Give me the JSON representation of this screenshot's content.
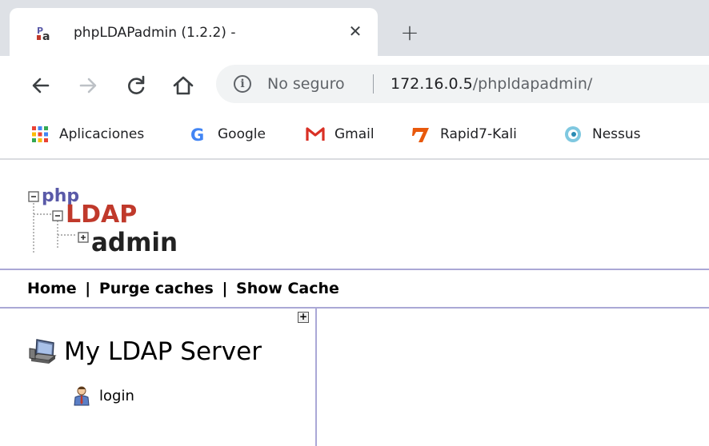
{
  "browser": {
    "tab": {
      "title": "phpLDAPadmin (1.2.2) -",
      "close_glyph": "✕"
    },
    "new_tab_glyph": "+",
    "toolbar": {
      "back_icon": "arrow-left-icon",
      "forward_icon": "arrow-right-icon",
      "reload_icon": "reload-icon",
      "home_icon": "home-icon"
    },
    "omnibox": {
      "security_label": "No seguro",
      "url_host": "172.16.0.5",
      "url_path": "/phpldapadmin/"
    },
    "bookmarks": [
      {
        "label": "Aplicaciones",
        "icon": "apps-grid-icon"
      },
      {
        "label": "Google",
        "icon": "google-icon"
      },
      {
        "label": "Gmail",
        "icon": "gmail-icon"
      },
      {
        "label": "Rapid7-Kali",
        "icon": "rapid7-icon"
      },
      {
        "label": "Nessus",
        "icon": "nessus-icon"
      }
    ]
  },
  "app": {
    "logo": {
      "line1": "php",
      "line2": "LDAP",
      "line3": "admin"
    },
    "menu": {
      "home": "Home",
      "separator": "|",
      "purge_caches": "Purge caches",
      "show_cache": "Show Cache"
    },
    "tree": {
      "expand_glyph": "+",
      "server_name": "My LDAP Server",
      "login_label": "login"
    }
  },
  "colors": {
    "tabstrip_bg": "#dee1e6",
    "omnibox_bg": "#f1f3f4",
    "pla_border": "#aaa8d6",
    "logo_red": "#c0392b",
    "logo_blue": "#5a5aa8"
  }
}
